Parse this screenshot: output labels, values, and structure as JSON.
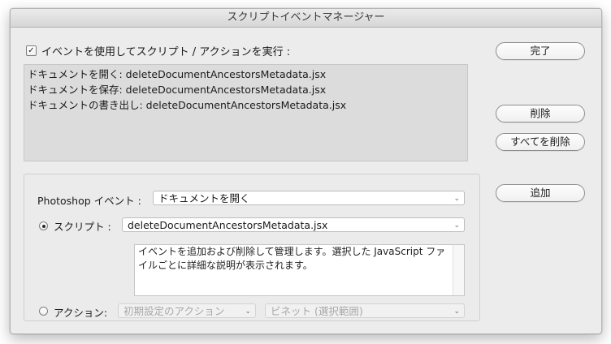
{
  "window": {
    "title": "スクリプトイベントマネージャー"
  },
  "enable": {
    "checked_glyph": "✓",
    "label": "イベントを使用してスクリプト / アクションを実行 :"
  },
  "events": [
    "ドキュメントを開く: deleteDocumentAncestorsMetadata.jsx",
    "ドキュメントを保存: deleteDocumentAncestorsMetadata.jsx",
    "ドキュメントの書き出し: deleteDocumentAncestorsMetadata.jsx"
  ],
  "buttons": {
    "done": "完了",
    "delete": "削除",
    "delete_all": "すべてを削除",
    "add": "追加"
  },
  "form": {
    "event_label": "Photoshop イベント :",
    "event_value": "ドキュメントを開く",
    "script_label": "スクリプト :",
    "script_value": "deleteDocumentAncestorsMetadata.jsx",
    "description": "イベントを追加および削除して管理します。選択した JavaScript ファイルごとに詳細な説明が表示されます。",
    "action_label": "アクション:",
    "action_set_value": "初期設定のアクション",
    "action_value": "ビネット (選択範囲)",
    "chevron": "⌄"
  }
}
